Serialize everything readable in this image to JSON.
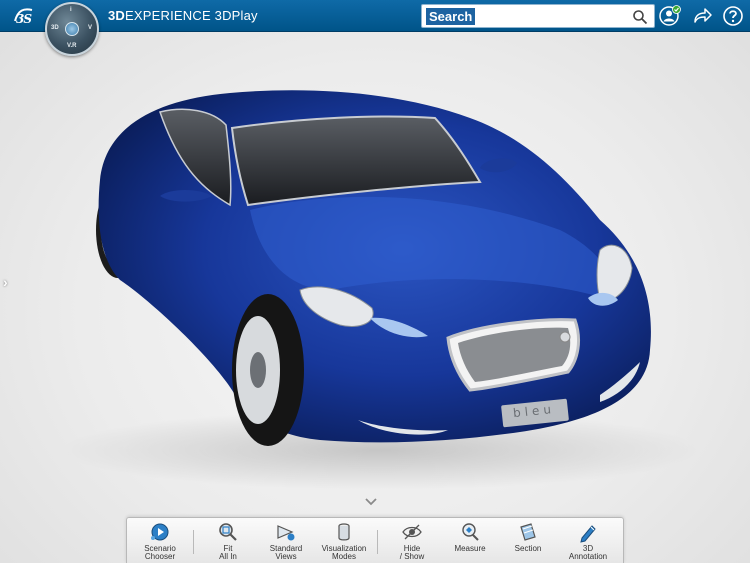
{
  "header": {
    "brand_icon": "3ds-logo",
    "title_bold": "3D",
    "title_rest": "EXPERIENCE 3DPlay",
    "search_placeholder": "Search",
    "compass_labels": {
      "top": "i",
      "left": "3D",
      "right": "V",
      "bottom": "V.R"
    },
    "icons": [
      "user-icon",
      "share-icon",
      "help-icon"
    ],
    "accent": "#005489"
  },
  "viewport": {
    "model_badge": "bleu",
    "model_color": "#1b3b9a"
  },
  "toolbar": {
    "tools": [
      {
        "label": "Scenario\nChooser",
        "icon": "scenario-chooser-icon"
      },
      {
        "label": "Fit\nAll In",
        "icon": "fit-all-icon"
      },
      {
        "label": "Standard\nViews",
        "icon": "standard-views-icon"
      },
      {
        "label": "Visualization\nModes",
        "icon": "visualization-modes-icon"
      },
      {
        "label": "Hide\n/ Show",
        "icon": "hide-show-icon"
      },
      {
        "label": "Measure",
        "icon": "measure-icon"
      },
      {
        "label": "Section",
        "icon": "section-icon"
      },
      {
        "label": "3D\nAnnotation",
        "icon": "annotation-icon"
      }
    ]
  }
}
